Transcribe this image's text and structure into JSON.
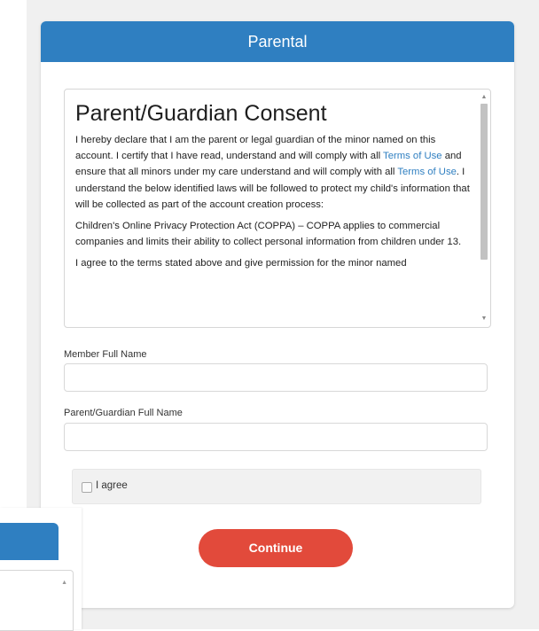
{
  "header": {
    "title": "Parental"
  },
  "consent": {
    "title": "Parent/Guardian Consent",
    "para1_a": "I hereby declare that I am the parent or legal guardian of the minor named on this account. I certify that I have read, understand and will comply with all ",
    "terms_link_1": "Terms of Use",
    "para1_b": " and ensure that all minors under my care understand and will comply with all ",
    "terms_link_2": "Terms of Use",
    "para1_c": ". I understand the below identified laws will be followed to protect my child's information that will be collected as part of the account creation process:",
    "para2": "Children's Online Privacy Protection Act (COPPA) – COPPA applies to commercial companies and limits their ability to collect personal information from children under 13.",
    "para3": "I agree to the terms stated above and give permission for the minor named"
  },
  "fields": {
    "member_label": "Member Full Name",
    "member_value": "",
    "guardian_label": "Parent/Guardian Full Name",
    "guardian_value": ""
  },
  "agree": {
    "label": "I agree",
    "checked": false
  },
  "continue_label": "Continue",
  "colors": {
    "header": "#2f7fc1",
    "button": "#e24a3b",
    "link": "#2f7fc1"
  },
  "icons": {
    "scroll_up": "scroll-up-arrow-icon",
    "scroll_down": "scroll-down-arrow-icon"
  }
}
